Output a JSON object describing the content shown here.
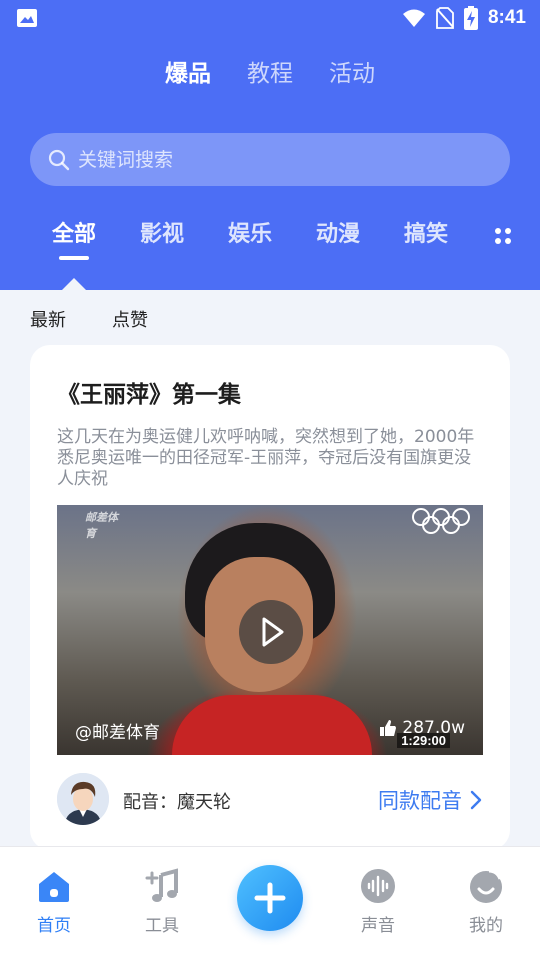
{
  "status_bar": {
    "time": "8:41"
  },
  "top_tabs": [
    {
      "label": "爆品",
      "active": true
    },
    {
      "label": "教程",
      "active": false
    },
    {
      "label": "活动",
      "active": false
    }
  ],
  "search": {
    "placeholder": "关键词搜索"
  },
  "categories": [
    {
      "label": "全部",
      "active": true
    },
    {
      "label": "影视",
      "active": false
    },
    {
      "label": "娱乐",
      "active": false
    },
    {
      "label": "动漫",
      "active": false
    },
    {
      "label": "搞笑",
      "active": false
    }
  ],
  "sort_tabs": [
    {
      "label": "最新"
    },
    {
      "label": "点赞"
    }
  ],
  "card": {
    "title": "《王丽萍》第一集",
    "description": "这几天在为奥运健儿欢呼呐喊，突然想到了她，2000年悉尼奥运唯一的田径冠军-王丽萍，夺冠后没有国旗更没人庆祝",
    "video": {
      "watermark": "邮差体育",
      "author": "@邮差体育",
      "likes": "287.0w",
      "duration": "1:29:00"
    },
    "dubber_label": "配音：魔天轮",
    "same_dub_label": "同款配音"
  },
  "bottom_nav": [
    {
      "label": "首页",
      "icon": "home-icon",
      "active": true
    },
    {
      "label": "工具",
      "icon": "music-note-icon",
      "active": false
    },
    {
      "label": "声音",
      "icon": "sound-wave-icon",
      "active": false
    },
    {
      "label": "我的",
      "icon": "profile-icon",
      "active": false
    }
  ],
  "colors": {
    "primary": "#4c6ef5",
    "accent_blue": "#2f7ff6",
    "link": "#3d7bf0",
    "background": "#f1f4fa"
  }
}
